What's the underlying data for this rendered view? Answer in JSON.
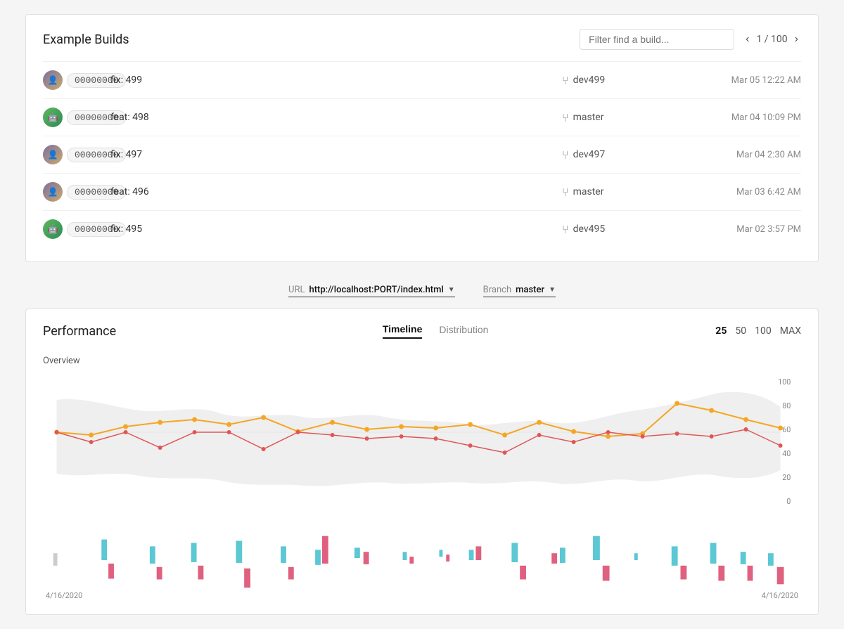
{
  "builds": {
    "title": "Example Builds",
    "filter_placeholder": "Filter find a build...",
    "pagination": {
      "current": 1,
      "total": 100,
      "label": "1 / 100"
    },
    "rows": [
      {
        "avatar_type": "human",
        "hash": "00000000",
        "message": "fix: 499",
        "branch": "dev499",
        "date": "Mar 05 12:22 AM"
      },
      {
        "avatar_type": "bot",
        "hash": "00000000",
        "message": "feat: 498",
        "branch": "master",
        "date": "Mar 04 10:09 PM"
      },
      {
        "avatar_type": "human",
        "hash": "00000000",
        "message": "fix: 497",
        "branch": "dev497",
        "date": "Mar 04 2:30 AM"
      },
      {
        "avatar_type": "human",
        "hash": "00000000",
        "message": "feat: 496",
        "branch": "master",
        "date": "Mar 03 6:42 AM"
      },
      {
        "avatar_type": "bot",
        "hash": "00000000",
        "message": "fix: 495",
        "branch": "dev495",
        "date": "Mar 02 3:57 PM"
      }
    ]
  },
  "url_bar": {
    "url_label": "URL",
    "url_value": "http://localhost:PORT/index.html",
    "branch_label": "Branch",
    "branch_value": "master"
  },
  "performance": {
    "title": "Performance",
    "tabs": [
      "Timeline",
      "Distribution"
    ],
    "active_tab": "Timeline",
    "counts": [
      "25",
      "50",
      "100",
      "MAX"
    ],
    "active_count": "25",
    "overview_label": "Overview",
    "date_left": "4/16/2020",
    "date_right": "4/16/2020",
    "y_axis": [
      "100",
      "80",
      "60",
      "40",
      "20",
      "0"
    ],
    "colors": {
      "orange_line": "#f5a623",
      "red_line": "#e05555",
      "band_fill": "#e8e8e8",
      "cyan_bar": "#5bc8d4",
      "pink_bar": "#e06080"
    }
  }
}
